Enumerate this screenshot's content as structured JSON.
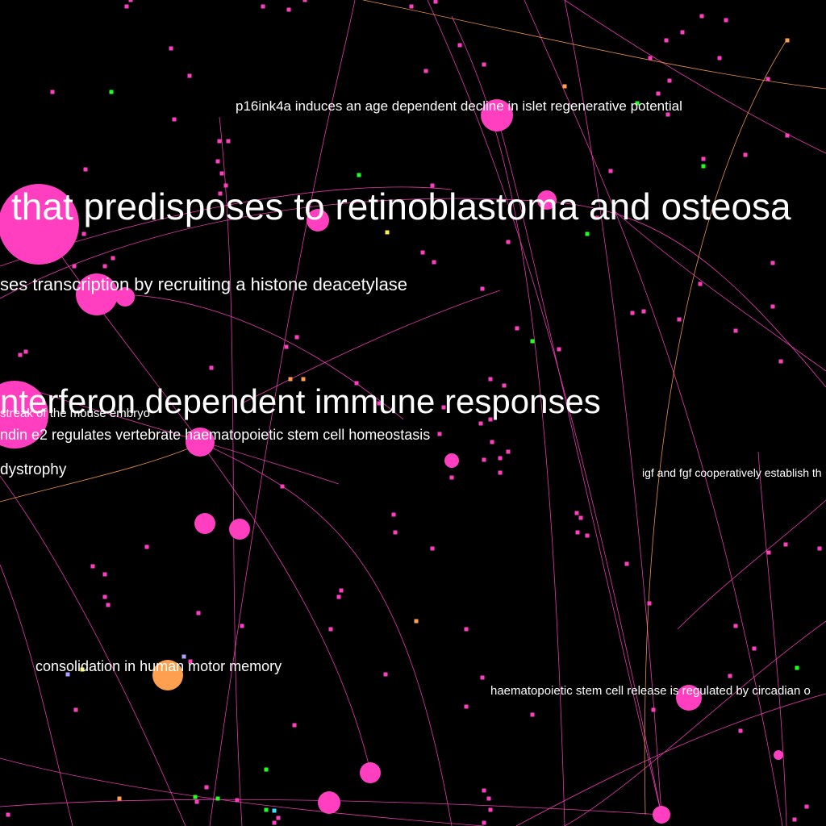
{
  "colors": {
    "background": "#000000",
    "node_primary": "#ff3fbf",
    "node_orange": "#ffa050",
    "node_green": "#20ff20",
    "node_yellow": "#ffee44",
    "node_cyan": "#40e0ff",
    "node_lavender": "#b0a0ff",
    "edge_pink": "#ff3fbf",
    "edge_orange": "#ffa050",
    "label": "#ffffff"
  },
  "labels": [
    {
      "id": "label-p16ink4a",
      "text": "p16ink4a induces an age dependent decline in islet regenerative potential"
    },
    {
      "id": "label-retinoblastoma",
      "text": "that predisposes to retinoblastoma and osteosa"
    },
    {
      "id": "label-histone-deacetylase",
      "text": "ses transcription by recruiting a histone deacetylase"
    },
    {
      "id": "label-interferon",
      "text": "nterferon dependent immune responses"
    },
    {
      "id": "label-primitive-streak",
      "text": "streak of the mouse embryo"
    },
    {
      "id": "label-prostaglandin",
      "text": "ndin e2 regulates vertebrate haematopoietic stem cell homeostasis"
    },
    {
      "id": "label-dystrophy",
      "text": "dystrophy"
    },
    {
      "id": "label-igf-fgf",
      "text": "igf and fgf cooperatively establish th"
    },
    {
      "id": "label-motor-memory",
      "text": "consolidation in human motor memory"
    },
    {
      "id": "label-circadian",
      "text": "haematopoietic stem cell release is regulated by circadian o"
    }
  ]
}
